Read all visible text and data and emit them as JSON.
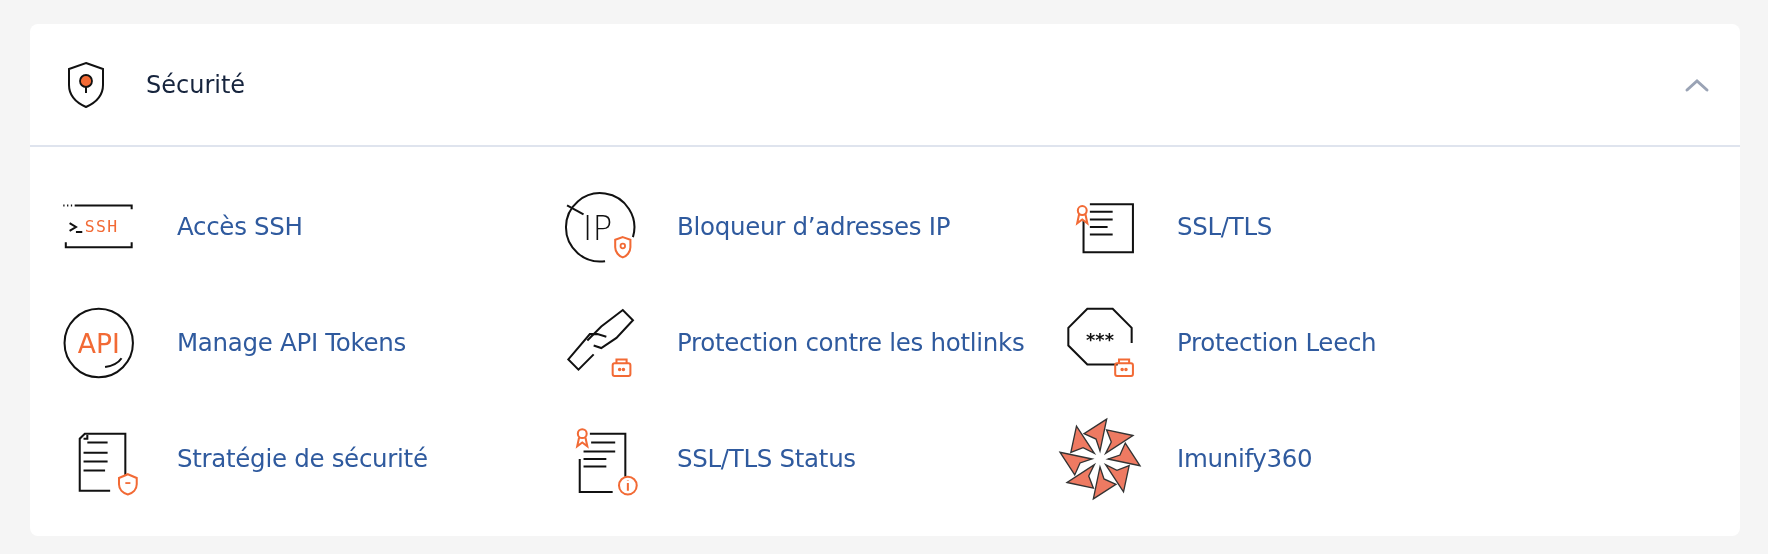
{
  "section": {
    "title": "Sécurité",
    "expanded": true
  },
  "items": [
    {
      "label": "Accès SSH",
      "kind": "ssh",
      "icon_label": "SSH"
    },
    {
      "label": "Bloqueur d’adresses IP",
      "kind": "ipblock",
      "icon_label": "IP"
    },
    {
      "label": "SSL/TLS",
      "kind": "cert"
    },
    {
      "label": "Manage API Tokens",
      "kind": "api",
      "icon_label": "API"
    },
    {
      "label": "Protection contre les hotlinks",
      "kind": "hotlink"
    },
    {
      "label": "Protection Leech",
      "kind": "leech",
      "icon_label": "***"
    },
    {
      "label": "Stratégie de sécurité",
      "kind": "policy"
    },
    {
      "label": "SSL/TLS Status",
      "kind": "certstatus"
    },
    {
      "label": "Imunify360",
      "kind": "imunify"
    }
  ]
}
